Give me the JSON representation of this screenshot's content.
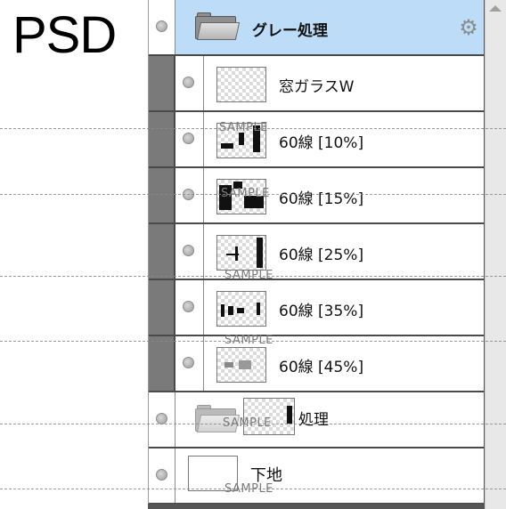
{
  "header_label": "PSD",
  "layers": [
    {
      "name": "グレー処理",
      "kind": "folder",
      "state": "open"
    },
    {
      "name": "窓ガラスW",
      "kind": "layer"
    },
    {
      "name": "60線 [10%]",
      "kind": "layer"
    },
    {
      "name": "60線 [15%]",
      "kind": "layer"
    },
    {
      "name": "60線 [25%]",
      "kind": "layer"
    },
    {
      "name": "60線 [35%]",
      "kind": "layer"
    },
    {
      "name": "60線 [45%]",
      "kind": "layer"
    },
    {
      "name": "処理",
      "kind": "folder",
      "state": "closed"
    },
    {
      "name": "下地",
      "kind": "layer"
    }
  ],
  "icons": {
    "settings": "gear-icon",
    "visibility": "eye-dot-icon",
    "folder": "folder-icon"
  },
  "watermark": "SAMPLE",
  "colors": {
    "selected_row": "#bcdcf8",
    "group_gutter": "#7a7a7a",
    "row_border": "#4a4a4a"
  }
}
